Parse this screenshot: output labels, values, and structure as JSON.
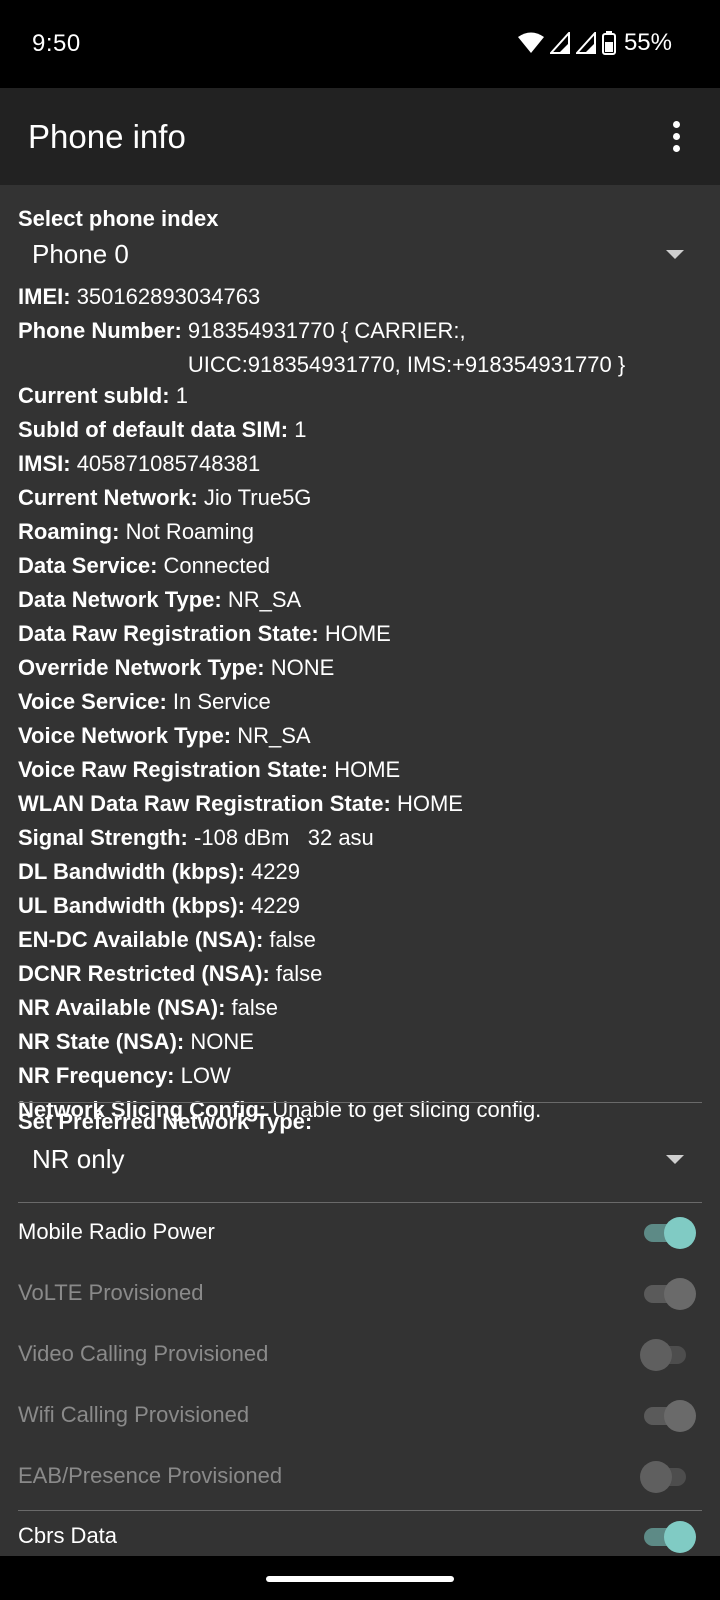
{
  "status_bar": {
    "time": "9:50",
    "battery": "55%",
    "icons": [
      "wifi-icon",
      "cell-signal-icon",
      "cell-signal-icon",
      "battery-icon"
    ]
  },
  "app_bar": {
    "title": "Phone info",
    "menu_icon": "more-vert-icon"
  },
  "phone_index": {
    "label": "Select phone index",
    "selected": "Phone 0"
  },
  "info": [
    {
      "key": "IMEI:",
      "value": "350162893034763"
    },
    {
      "key": "Phone Number:",
      "value": "918354931770 { CARRIER:,",
      "value2": "UICC:918354931770, IMS:+918354931770 }"
    },
    {
      "key": "Current subId:",
      "value": "1"
    },
    {
      "key": "SubId of default data SIM:",
      "value": "1"
    },
    {
      "key": "IMSI:",
      "value": "405871085748381"
    },
    {
      "key": "Current Network:",
      "value": "Jio True5G"
    },
    {
      "key": "Roaming:",
      "value": "Not Roaming"
    },
    {
      "key": "Data Service:",
      "value": "Connected"
    },
    {
      "key": "Data Network Type:",
      "value": "NR_SA"
    },
    {
      "key": "Data Raw Registration State:",
      "value": "HOME"
    },
    {
      "key": "Override Network Type:",
      "value": "NONE"
    },
    {
      "key": "Voice Service:",
      "value": "In Service"
    },
    {
      "key": "Voice Network Type:",
      "value": "NR_SA"
    },
    {
      "key": "Voice Raw Registration State:",
      "value": "HOME"
    },
    {
      "key": "WLAN Data Raw Registration State:",
      "value": "HOME"
    },
    {
      "key": "Signal Strength:",
      "value": "-108 dBm   32 asu"
    },
    {
      "key": "DL Bandwidth (kbps):",
      "value": "4229"
    },
    {
      "key": "UL Bandwidth (kbps):",
      "value": "4229"
    },
    {
      "key": "EN-DC Available (NSA):",
      "value": "false"
    },
    {
      "key": "DCNR Restricted (NSA):",
      "value": "false"
    },
    {
      "key": "NR Available (NSA):",
      "value": "false"
    },
    {
      "key": "NR State (NSA):",
      "value": "NONE"
    },
    {
      "key": "NR Frequency:",
      "value": "LOW"
    },
    {
      "key": "Network Slicing Config:",
      "value": "Unable to get slicing config."
    }
  ],
  "preferred_network": {
    "label": "Set Preferred Network Type:",
    "selected": "NR only"
  },
  "switches": [
    {
      "label": "Mobile Radio Power",
      "state": "on",
      "enabled": true
    },
    {
      "label": "VoLTE Provisioned",
      "state": "on",
      "enabled": false
    },
    {
      "label": "Video Calling Provisioned",
      "state": "off",
      "enabled": false
    },
    {
      "label": "Wifi Calling Provisioned",
      "state": "on",
      "enabled": false
    },
    {
      "label": "EAB/Presence Provisioned",
      "state": "off",
      "enabled": false
    },
    {
      "label": "Cbrs Data",
      "state": "on",
      "enabled": true
    }
  ],
  "colors": {
    "background": "#333333",
    "app_bar": "#222222",
    "accent": "#80cbc4"
  }
}
